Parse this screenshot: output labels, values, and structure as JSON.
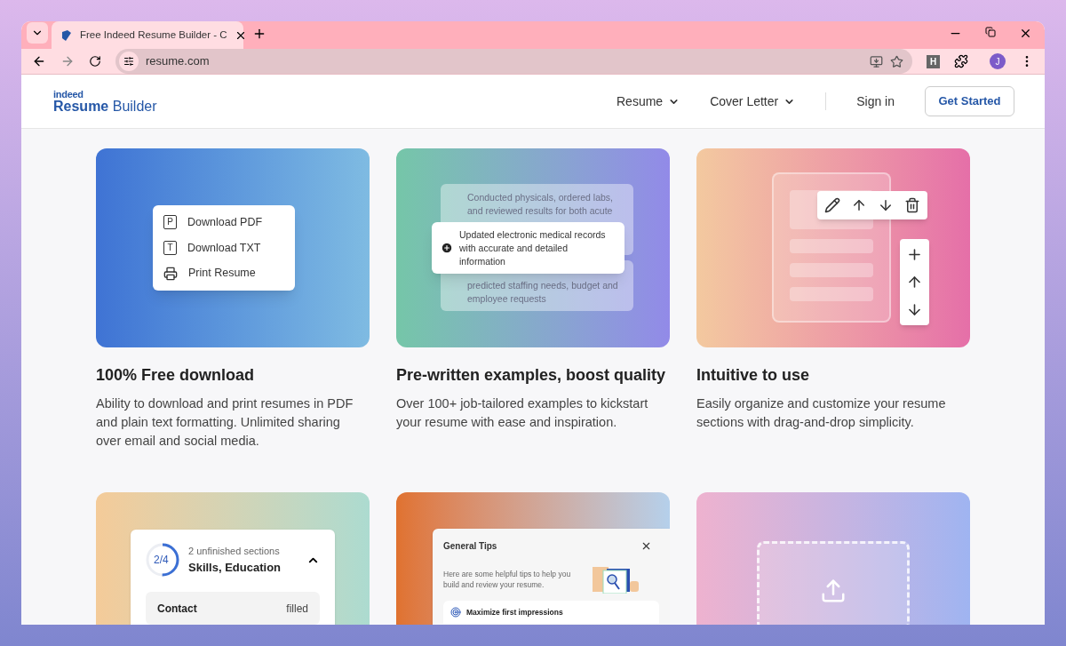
{
  "browser": {
    "tab_title": "Free Indeed Resume Builder - C",
    "url": "resume.com",
    "extension_label": "H",
    "profile_initial": "J"
  },
  "header": {
    "logo_top": "indeed",
    "logo_bold": "Resume",
    "logo_rest": "Builder",
    "nav": [
      {
        "label": "Resume"
      },
      {
        "label": "Cover Letter"
      }
    ],
    "sign_in": "Sign in",
    "cta": "Get Started"
  },
  "features": [
    {
      "kind": "download",
      "title": "100% Free download",
      "description": "Ability to download and print resumes in PDF and plain text formatting. Unlimited sharing over email and social media.",
      "menu": [
        {
          "kind": "letter",
          "glyph": "P",
          "label": "Download PDF"
        },
        {
          "kind": "letter",
          "glyph": "T",
          "label": "Download TXT"
        },
        {
          "kind": "printer",
          "label": "Print Resume"
        }
      ]
    },
    {
      "kind": "examples",
      "title": "Pre-written examples, boost quality",
      "description": "Over 100+ job-tailored examples to kickstart your resume with ease and inspiration.",
      "back_top": "Conducted physicals, ordered labs, and reviewed results for both acute",
      "front": "Updated electronic medical records with accurate and detailed information",
      "back_bottom": "predicted staffing needs, budget and employee requests"
    },
    {
      "kind": "editor",
      "title": "Intuitive to use",
      "description": "Easily organize and customize your resume sections with drag-and-drop simplicity."
    },
    {
      "kind": "progress",
      "ring": "2/4",
      "level": 0.5,
      "subtitle": "2 unfinished sections",
      "heading": "Skills, Education",
      "expanded": true,
      "rows": [
        {
          "label": "Contact",
          "status": "filled"
        }
      ]
    },
    {
      "kind": "tips",
      "heading": "General Tips",
      "body": "Here are some helpful tips to help you build and review your resume.",
      "items": [
        "Maximize first impressions"
      ]
    },
    {
      "kind": "upload"
    }
  ]
}
